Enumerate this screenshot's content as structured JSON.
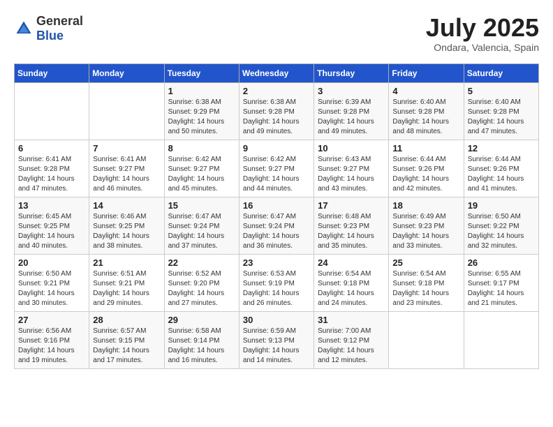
{
  "header": {
    "logo_general": "General",
    "logo_blue": "Blue",
    "month_year": "July 2025",
    "location": "Ondara, Valencia, Spain"
  },
  "days_of_week": [
    "Sunday",
    "Monday",
    "Tuesday",
    "Wednesday",
    "Thursday",
    "Friday",
    "Saturday"
  ],
  "weeks": [
    [
      {
        "day": "",
        "info": ""
      },
      {
        "day": "",
        "info": ""
      },
      {
        "day": "1",
        "info": "Sunrise: 6:38 AM\nSunset: 9:29 PM\nDaylight: 14 hours and 50 minutes."
      },
      {
        "day": "2",
        "info": "Sunrise: 6:38 AM\nSunset: 9:28 PM\nDaylight: 14 hours and 49 minutes."
      },
      {
        "day": "3",
        "info": "Sunrise: 6:39 AM\nSunset: 9:28 PM\nDaylight: 14 hours and 49 minutes."
      },
      {
        "day": "4",
        "info": "Sunrise: 6:40 AM\nSunset: 9:28 PM\nDaylight: 14 hours and 48 minutes."
      },
      {
        "day": "5",
        "info": "Sunrise: 6:40 AM\nSunset: 9:28 PM\nDaylight: 14 hours and 47 minutes."
      }
    ],
    [
      {
        "day": "6",
        "info": "Sunrise: 6:41 AM\nSunset: 9:28 PM\nDaylight: 14 hours and 47 minutes."
      },
      {
        "day": "7",
        "info": "Sunrise: 6:41 AM\nSunset: 9:27 PM\nDaylight: 14 hours and 46 minutes."
      },
      {
        "day": "8",
        "info": "Sunrise: 6:42 AM\nSunset: 9:27 PM\nDaylight: 14 hours and 45 minutes."
      },
      {
        "day": "9",
        "info": "Sunrise: 6:42 AM\nSunset: 9:27 PM\nDaylight: 14 hours and 44 minutes."
      },
      {
        "day": "10",
        "info": "Sunrise: 6:43 AM\nSunset: 9:27 PM\nDaylight: 14 hours and 43 minutes."
      },
      {
        "day": "11",
        "info": "Sunrise: 6:44 AM\nSunset: 9:26 PM\nDaylight: 14 hours and 42 minutes."
      },
      {
        "day": "12",
        "info": "Sunrise: 6:44 AM\nSunset: 9:26 PM\nDaylight: 14 hours and 41 minutes."
      }
    ],
    [
      {
        "day": "13",
        "info": "Sunrise: 6:45 AM\nSunset: 9:25 PM\nDaylight: 14 hours and 40 minutes."
      },
      {
        "day": "14",
        "info": "Sunrise: 6:46 AM\nSunset: 9:25 PM\nDaylight: 14 hours and 38 minutes."
      },
      {
        "day": "15",
        "info": "Sunrise: 6:47 AM\nSunset: 9:24 PM\nDaylight: 14 hours and 37 minutes."
      },
      {
        "day": "16",
        "info": "Sunrise: 6:47 AM\nSunset: 9:24 PM\nDaylight: 14 hours and 36 minutes."
      },
      {
        "day": "17",
        "info": "Sunrise: 6:48 AM\nSunset: 9:23 PM\nDaylight: 14 hours and 35 minutes."
      },
      {
        "day": "18",
        "info": "Sunrise: 6:49 AM\nSunset: 9:23 PM\nDaylight: 14 hours and 33 minutes."
      },
      {
        "day": "19",
        "info": "Sunrise: 6:50 AM\nSunset: 9:22 PM\nDaylight: 14 hours and 32 minutes."
      }
    ],
    [
      {
        "day": "20",
        "info": "Sunrise: 6:50 AM\nSunset: 9:21 PM\nDaylight: 14 hours and 30 minutes."
      },
      {
        "day": "21",
        "info": "Sunrise: 6:51 AM\nSunset: 9:21 PM\nDaylight: 14 hours and 29 minutes."
      },
      {
        "day": "22",
        "info": "Sunrise: 6:52 AM\nSunset: 9:20 PM\nDaylight: 14 hours and 27 minutes."
      },
      {
        "day": "23",
        "info": "Sunrise: 6:53 AM\nSunset: 9:19 PM\nDaylight: 14 hours and 26 minutes."
      },
      {
        "day": "24",
        "info": "Sunrise: 6:54 AM\nSunset: 9:18 PM\nDaylight: 14 hours and 24 minutes."
      },
      {
        "day": "25",
        "info": "Sunrise: 6:54 AM\nSunset: 9:18 PM\nDaylight: 14 hours and 23 minutes."
      },
      {
        "day": "26",
        "info": "Sunrise: 6:55 AM\nSunset: 9:17 PM\nDaylight: 14 hours and 21 minutes."
      }
    ],
    [
      {
        "day": "27",
        "info": "Sunrise: 6:56 AM\nSunset: 9:16 PM\nDaylight: 14 hours and 19 minutes."
      },
      {
        "day": "28",
        "info": "Sunrise: 6:57 AM\nSunset: 9:15 PM\nDaylight: 14 hours and 17 minutes."
      },
      {
        "day": "29",
        "info": "Sunrise: 6:58 AM\nSunset: 9:14 PM\nDaylight: 14 hours and 16 minutes."
      },
      {
        "day": "30",
        "info": "Sunrise: 6:59 AM\nSunset: 9:13 PM\nDaylight: 14 hours and 14 minutes."
      },
      {
        "day": "31",
        "info": "Sunrise: 7:00 AM\nSunset: 9:12 PM\nDaylight: 14 hours and 12 minutes."
      },
      {
        "day": "",
        "info": ""
      },
      {
        "day": "",
        "info": ""
      }
    ]
  ]
}
